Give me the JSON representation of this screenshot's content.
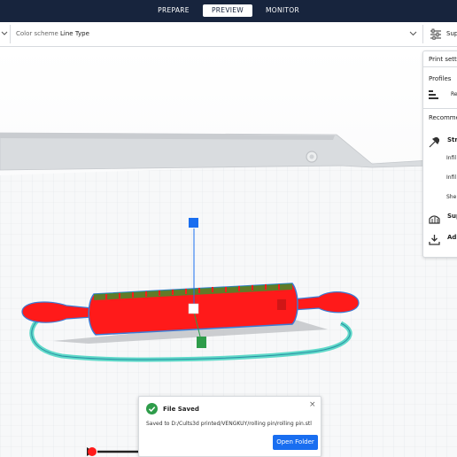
{
  "header": {
    "tabs": [
      {
        "label": "PREPARE",
        "active": false
      },
      {
        "label": "PREVIEW",
        "active": true
      },
      {
        "label": "MONITOR",
        "active": false
      }
    ]
  },
  "toolbar": {
    "color_scheme_label": "Color scheme",
    "color_scheme_value": "Line Type",
    "print_settings_button": "Sup"
  },
  "print_panel": {
    "title": "Print setti",
    "profiles_label": "Profiles",
    "profile_value": "Re",
    "recommended_label": "Recomme",
    "strength_label": "Stre",
    "infill_density_label": "Infil",
    "infill_pattern_label": "Infil",
    "shell_label": "She",
    "support_label": "Sup",
    "adhesion_label": "Adh"
  },
  "toast": {
    "title": "File Saved",
    "message": "Saved to D:/Cults3d printed/VENGKUY/rolling pin/rolling pin.stl",
    "button_label": "Open Folder",
    "close_icon": "×"
  },
  "colors": {
    "topbar": "#17243d",
    "accent_blue": "#196ef0",
    "model_red": "#ff1a1a",
    "brim_cyan": "#5fd9c9",
    "success_green": "#2e9c4a"
  }
}
